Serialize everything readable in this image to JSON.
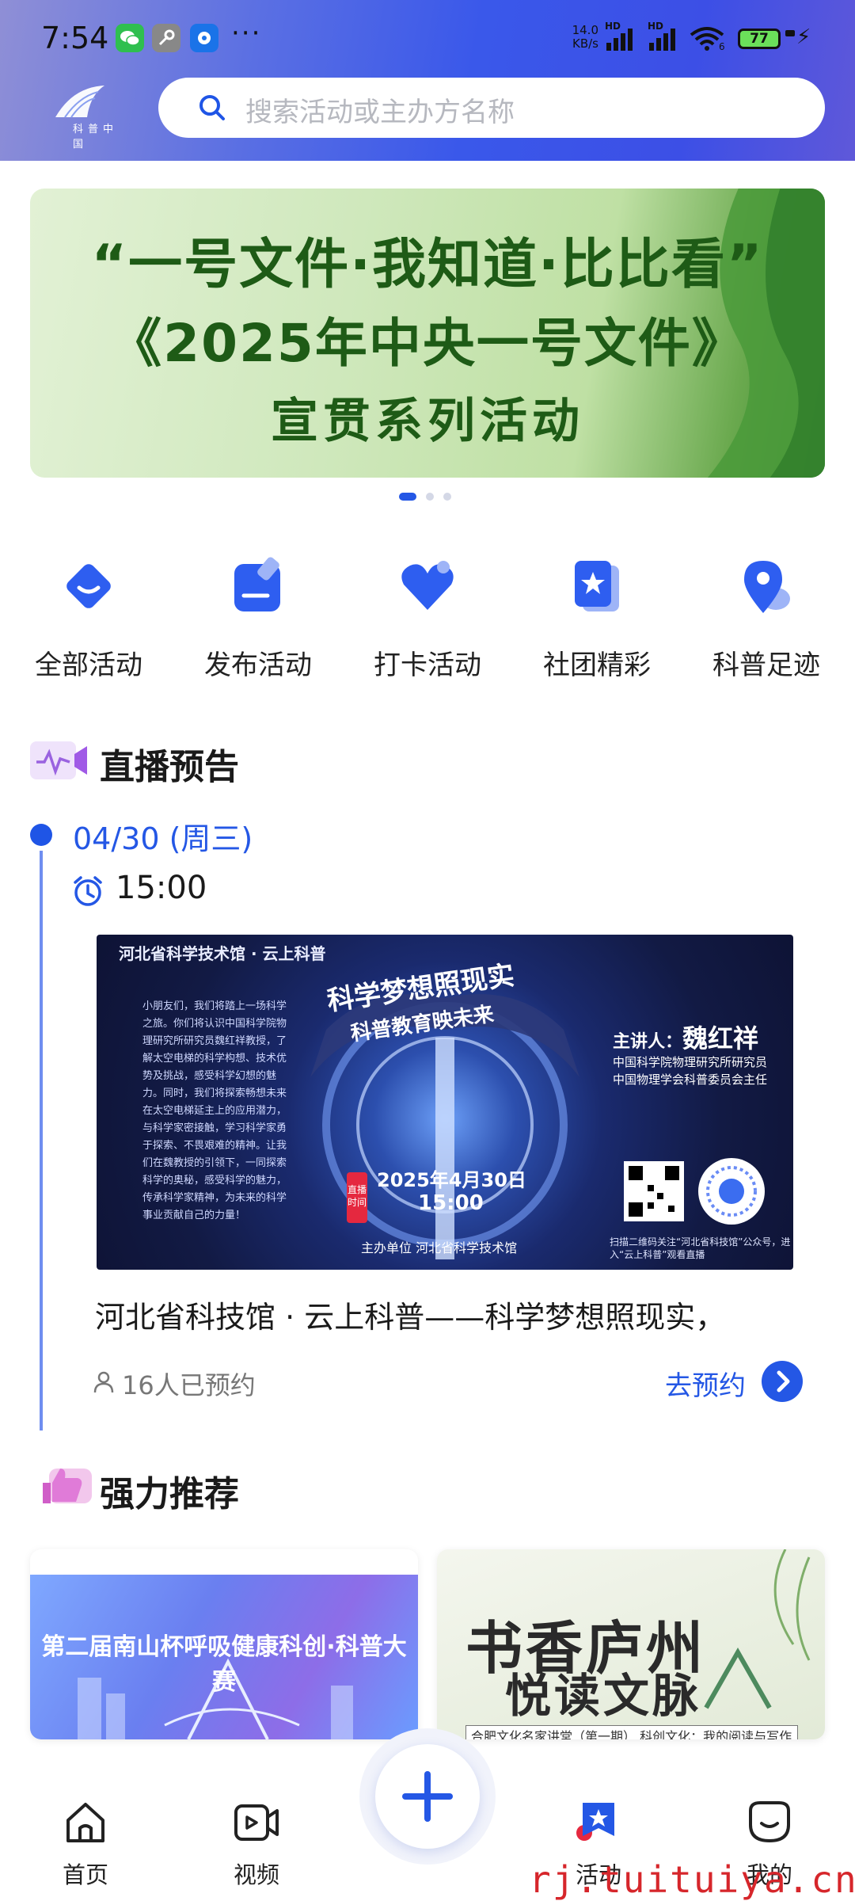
{
  "status_bar": {
    "time": "7:54",
    "more": "···",
    "net_speed_value": "14.0",
    "net_speed_unit": "KB/s",
    "signal_label_1": "HD",
    "signal_label_2": "HD",
    "wifi_label": "6",
    "battery": "77"
  },
  "header": {
    "logo_text": "科普中国",
    "search_placeholder": "搜索活动或主办方名称"
  },
  "banner": {
    "line1": "“一号文件·我知道·比比看”",
    "line2": "《2025年中央一号文件》",
    "line3": "宣贯系列活动",
    "active_index": 0,
    "count": 3
  },
  "quick_menu": [
    {
      "label": "全部活动",
      "icon": "diamond-smile-icon"
    },
    {
      "label": "发布活动",
      "icon": "edit-icon"
    },
    {
      "label": "打卡活动",
      "icon": "heart-icon"
    },
    {
      "label": "社团精彩",
      "icon": "star-badge-icon"
    },
    {
      "label": "科普足迹",
      "icon": "location-pin-icon"
    }
  ],
  "live_preview": {
    "section_title": "直播预告",
    "date": "04/30 (周三)",
    "time": "15:00",
    "poster": {
      "header": "河北省科学技术馆 · 云上科普",
      "title": "科学梦想照现实",
      "subtitle": "科普教育映未来",
      "body": "小朋友们，我们将踏上一场科学之旅。你们将认识中国科学院物理研究所研究员魏红祥教授，了解太空电梯的科学构想、技术优势及挑战，感受科学幻想的魅力。同时，我们将探索畅想未来在太空电梯延主上的应用潜力，与科学家密接触，学习科学家勇于探索、不畏艰难的精神。让我们在魏教授的引领下，一同探索科学的奥秘，感受科学的魅力，传承科学家精神，为未来的科学事业贡献自己的力量！",
      "speaker_prefix": "主讲人：",
      "speaker_name": "魏红祥",
      "speaker_role_1": "中国科学院物理研究所研究员",
      "speaker_role_2": "中国物理学会科普委员会主任",
      "badge": "直播时间",
      "event_date": "2025年4月30日",
      "event_time": "15:00",
      "organizer": "主办单位 河北省科学技术馆",
      "footer": "扫描二维码关注“河北省科技馆”公众号，进入“云上科普”观看直播"
    },
    "event_title": "河北省科技馆 · 云上科普——科学梦想照现实，",
    "reserved_count": "16人已预约",
    "reserve_label": "去预约"
  },
  "recommend": {
    "section_title": "强力推荐",
    "cards": [
      {
        "title": "第二届南山杯呼吸健康科创·科普大赛"
      },
      {
        "title_big": "书香庐州",
        "title_small": "悦读文脉",
        "caption": "合肥文化名家讲堂（第一期） 科创文化：我的阅读与写作"
      }
    ]
  },
  "bottom_nav": [
    {
      "label": "首页",
      "icon": "home-icon"
    },
    {
      "label": "视频",
      "icon": "video-icon"
    },
    {
      "label": "活动",
      "icon": "activity-icon",
      "active": true
    },
    {
      "label": "我的",
      "icon": "profile-icon"
    }
  ],
  "watermark": "rj.tuituiya.cn",
  "colors": {
    "accent": "#2457e5",
    "header_start": "#8f8fd6",
    "header_end": "#3a58ea",
    "banner_text": "#1e5b16",
    "watermark": "#d6262b"
  }
}
